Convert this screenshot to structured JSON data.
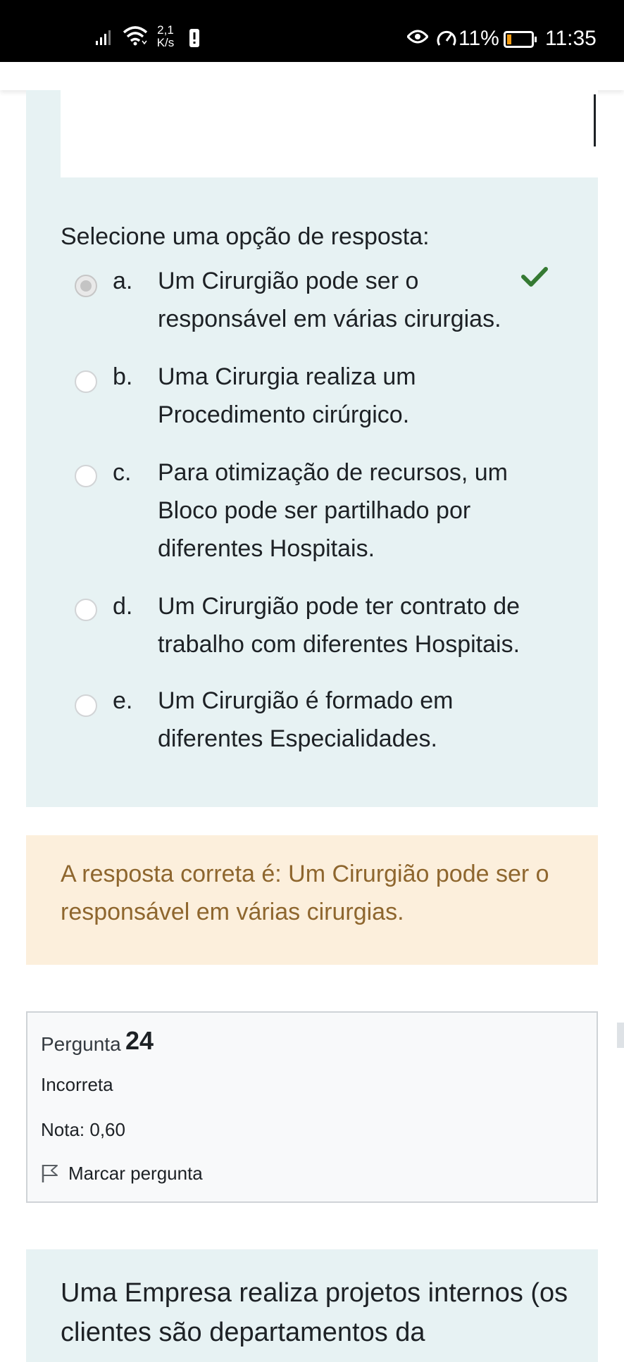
{
  "status_bar": {
    "net_speed_value": "2,1",
    "net_speed_unit": "K/s",
    "battery_percent": "11%",
    "time": "11:35",
    "icons": [
      "signal-icon",
      "wifi-icon",
      "alert-icon",
      "eye-icon",
      "gauge-icon",
      "battery-icon"
    ]
  },
  "question": {
    "prompt": "Selecione uma opção de resposta:",
    "options": [
      {
        "letter": "a.",
        "text": "Um Cirurgião pode ser o responsável em várias cirurgias.",
        "selected": true,
        "correct": true
      },
      {
        "letter": "b.",
        "text": "Uma Cirurgia realiza um Procedimento cirúrgico.",
        "selected": false
      },
      {
        "letter": "c.",
        "text": "Para otimização de recursos, um Bloco pode ser partilhado por diferentes Hospitais.",
        "selected": false
      },
      {
        "letter": "d.",
        "text": "Um Cirurgião pode ter contrato de trabalho com diferentes Hospitais.",
        "selected": false
      },
      {
        "letter": "e.",
        "text": "Um Cirurgião é formado em diferentes Especialidades.",
        "selected": false
      }
    ]
  },
  "feedback": {
    "text": "A resposta correta é: Um Cirurgião pode ser o responsável em várias cirurgias."
  },
  "next_question_info": {
    "label": "Pergunta",
    "number": "24",
    "status": "Incorreta",
    "grade": "Nota: 0,60",
    "flag_label": "Marcar pergunta"
  },
  "next_question": {
    "text": "Uma Empresa realiza projetos internos (os clientes são departamentos da"
  },
  "colors": {
    "panel_bg": "#e7f2f3",
    "feedback_bg": "#fcefdc",
    "feedback_text": "#8e662e",
    "correct_check": "#357a32"
  }
}
